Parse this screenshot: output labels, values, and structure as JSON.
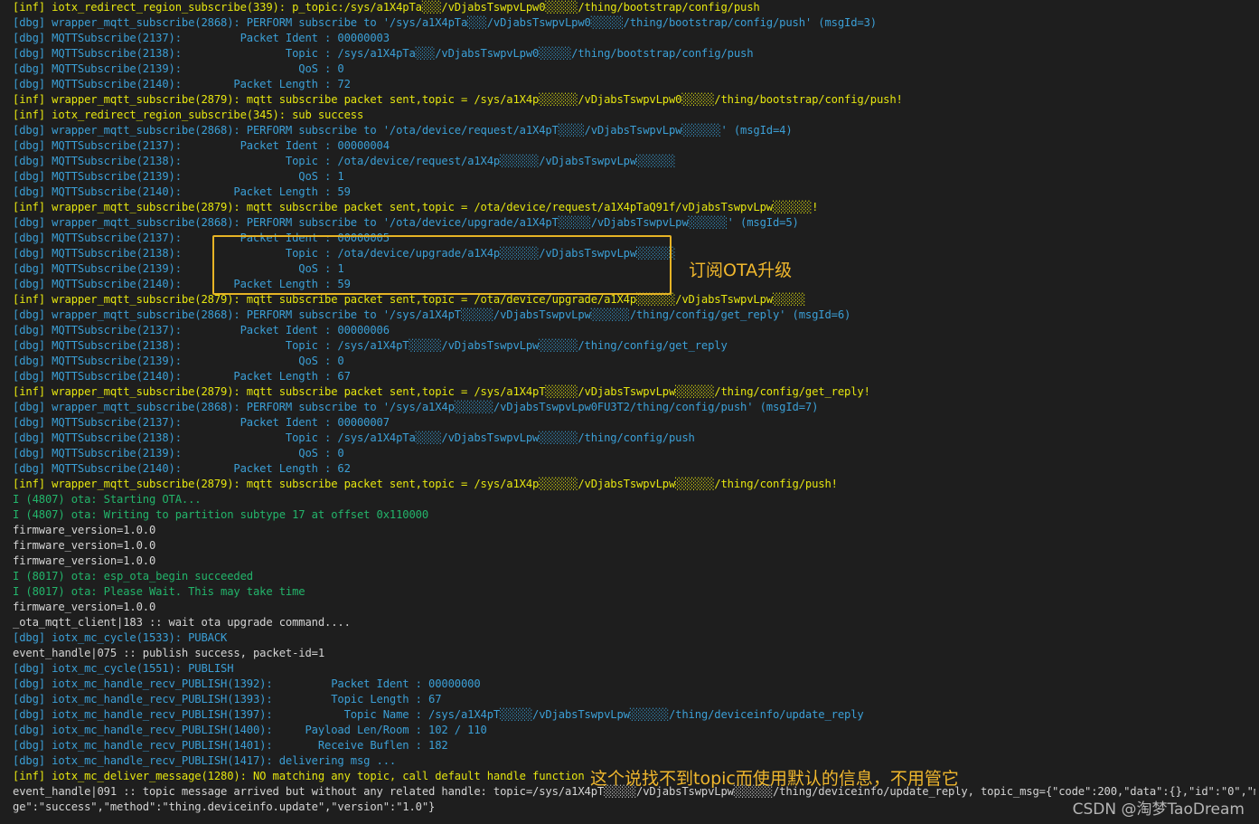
{
  "terminal": {
    "lines": [
      {
        "t": "[inf] iotx_redirect_region_subscribe(339): p_topic:/sys/a1X4pTa░░░/vDjabsTswpvLpw0░░░░░/thing/bootstrap/config/push",
        "k": "inf"
      },
      {
        "t": "[dbg] wrapper_mqtt_subscribe(2868): PERFORM subscribe to '/sys/a1X4pTa░░░/vDjabsTswpvLpw0░░░░░/thing/bootstrap/config/push' (msgId=3)",
        "k": "dbg"
      },
      {
        "t": "[dbg] MQTTSubscribe(2137):         Packet Ident : 00000003",
        "k": "dbg"
      },
      {
        "t": "[dbg] MQTTSubscribe(2138):                Topic : /sys/a1X4pTa░░░/vDjabsTswpvLpw0░░░░░/thing/bootstrap/config/push",
        "k": "dbg"
      },
      {
        "t": "[dbg] MQTTSubscribe(2139):                  QoS : 0",
        "k": "dbg"
      },
      {
        "t": "[dbg] MQTTSubscribe(2140):        Packet Length : 72",
        "k": "dbg"
      },
      {
        "t": "[inf] wrapper_mqtt_subscribe(2879): mqtt subscribe packet sent,topic = /sys/a1X4p░░░░░░/vDjabsTswpvLpw0░░░░░/thing/bootstrap/config/push!",
        "k": "inf"
      },
      {
        "t": "[inf] iotx_redirect_region_subscribe(345): sub success",
        "k": "inf"
      },
      {
        "t": "[dbg] wrapper_mqtt_subscribe(2868): PERFORM subscribe to '/ota/device/request/a1X4pT░░░░/vDjabsTswpvLpw░░░░░░' (msgId=4)",
        "k": "dbg"
      },
      {
        "t": "[dbg] MQTTSubscribe(2137):         Packet Ident : 00000004",
        "k": "dbg"
      },
      {
        "t": "[dbg] MQTTSubscribe(2138):                Topic : /ota/device/request/a1X4p░░░░░░/vDjabsTswpvLpw░░░░░░",
        "k": "dbg"
      },
      {
        "t": "[dbg] MQTTSubscribe(2139):                  QoS : 1",
        "k": "dbg"
      },
      {
        "t": "[dbg] MQTTSubscribe(2140):        Packet Length : 59",
        "k": "dbg"
      },
      {
        "t": "[inf] wrapper_mqtt_subscribe(2879): mqtt subscribe packet sent,topic = /ota/device/request/a1X4pTaQ91f/vDjabsTswpvLpw░░░░░░!",
        "k": "inf"
      },
      {
        "t": "[dbg] wrapper_mqtt_subscribe(2868): PERFORM subscribe to '/ota/device/upgrade/a1X4pT░░░░░/vDjabsTswpvLpw░░░░░░' (msgId=5)",
        "k": "dbg"
      },
      {
        "t": "[dbg] MQTTSubscribe(2137):         Packet Ident : 00000005",
        "k": "dbg"
      },
      {
        "t": "[dbg] MQTTSubscribe(2138):                Topic : /ota/device/upgrade/a1X4p░░░░░░/vDjabsTswpvLpw░░░░░░",
        "k": "dbg"
      },
      {
        "t": "[dbg] MQTTSubscribe(2139):                  QoS : 1",
        "k": "dbg"
      },
      {
        "t": "[dbg] MQTTSubscribe(2140):        Packet Length : 59",
        "k": "dbg"
      },
      {
        "t": "[inf] wrapper_mqtt_subscribe(2879): mqtt subscribe packet sent,topic = /ota/device/upgrade/a1X4p░░░░░░/vDjabsTswpvLpw░░░░░",
        "k": "inf"
      },
      {
        "t": "[dbg] wrapper_mqtt_subscribe(2868): PERFORM subscribe to '/sys/a1X4pT░░░░░/vDjabsTswpvLpw░░░░░░/thing/config/get_reply' (msgId=6)",
        "k": "dbg"
      },
      {
        "t": "[dbg] MQTTSubscribe(2137):         Packet Ident : 00000006",
        "k": "dbg"
      },
      {
        "t": "[dbg] MQTTSubscribe(2138):                Topic : /sys/a1X4pT░░░░░/vDjabsTswpvLpw░░░░░░/thing/config/get_reply",
        "k": "dbg"
      },
      {
        "t": "[dbg] MQTTSubscribe(2139):                  QoS : 0",
        "k": "dbg"
      },
      {
        "t": "[dbg] MQTTSubscribe(2140):        Packet Length : 67",
        "k": "dbg"
      },
      {
        "t": "[inf] wrapper_mqtt_subscribe(2879): mqtt subscribe packet sent,topic = /sys/a1X4pT░░░░░/vDjabsTswpvLpw░░░░░░/thing/config/get_reply!",
        "k": "inf"
      },
      {
        "t": "[dbg] wrapper_mqtt_subscribe(2868): PERFORM subscribe to '/sys/a1X4p░░░░░░/vDjabsTswpvLpw0FU3T2/thing/config/push' (msgId=7)",
        "k": "dbg"
      },
      {
        "t": "[dbg] MQTTSubscribe(2137):         Packet Ident : 00000007",
        "k": "dbg"
      },
      {
        "t": "[dbg] MQTTSubscribe(2138):                Topic : /sys/a1X4pTa░░░░/vDjabsTswpvLpw░░░░░░/thing/config/push",
        "k": "dbg"
      },
      {
        "t": "[dbg] MQTTSubscribe(2139):                  QoS : 0",
        "k": "dbg"
      },
      {
        "t": "[dbg] MQTTSubscribe(2140):        Packet Length : 62",
        "k": "dbg"
      },
      {
        "t": "[inf] wrapper_mqtt_subscribe(2879): mqtt subscribe packet sent,topic = /sys/a1X4p░░░░░░/vDjabsTswpvLpw░░░░░░/thing/config/push!",
        "k": "inf"
      },
      {
        "t": "I (4807) ota: Starting OTA...",
        "k": "ota"
      },
      {
        "t": "I (4807) ota: Writing to partition subtype 17 at offset 0x110000",
        "k": "ota"
      },
      {
        "t": "firmware_version=1.0.0",
        "k": "plain"
      },
      {
        "t": "firmware_version=1.0.0",
        "k": "plain"
      },
      {
        "t": "firmware_version=1.0.0",
        "k": "plain"
      },
      {
        "t": "I (8017) ota: esp_ota_begin succeeded",
        "k": "ota"
      },
      {
        "t": "I (8017) ota: Please Wait. This may take time",
        "k": "ota"
      },
      {
        "t": "firmware_version=1.0.0",
        "k": "plain"
      },
      {
        "t": "_ota_mqtt_client|183 :: wait ota upgrade command....",
        "k": "plain"
      },
      {
        "t": "[dbg] iotx_mc_cycle(1533): PUBACK",
        "k": "dbg"
      },
      {
        "t": "event_handle|075 :: publish success, packet-id=1",
        "k": "plain"
      },
      {
        "t": "[dbg] iotx_mc_cycle(1551): PUBLISH",
        "k": "dbg"
      },
      {
        "t": "[dbg] iotx_mc_handle_recv_PUBLISH(1392):         Packet Ident : 00000000",
        "k": "dbg"
      },
      {
        "t": "[dbg] iotx_mc_handle_recv_PUBLISH(1393):         Topic Length : 67",
        "k": "dbg"
      },
      {
        "t": "[dbg] iotx_mc_handle_recv_PUBLISH(1397):           Topic Name : /sys/a1X4pT░░░░░/vDjabsTswpvLpw░░░░░░/thing/deviceinfo/update_reply",
        "k": "dbg"
      },
      {
        "t": "[dbg] iotx_mc_handle_recv_PUBLISH(1400):     Payload Len/Room : 102 / 110",
        "k": "dbg"
      },
      {
        "t": "[dbg] iotx_mc_handle_recv_PUBLISH(1401):       Receive Buflen : 182",
        "k": "dbg"
      },
      {
        "t": "[dbg] iotx_mc_handle_recv_PUBLISH(1417): delivering msg ...",
        "k": "dbg"
      },
      {
        "t": "[inf] iotx_mc_deliver_message(1280): NO matching any topic, call default handle function",
        "k": "inf"
      },
      {
        "t": "event_handle|091 :: topic message arrived but without any related handle: topic=/sys/a1X4pT░░░░░/vDjabsTswpvLpw░░░░░░/thing/deviceinfo/update_reply, topic_msg={\"code\":200,\"data\":{},\"id\":\"0\",\"messa",
        "k": "plain"
      },
      {
        "t": "ge\":\"success\",\"method\":\"thing.deviceinfo.update\",\"version\":\"1.0\"}",
        "k": "plain"
      }
    ]
  },
  "annotations": {
    "ota_note": "订阅OTA升级",
    "topic_note": "这个说找不到topic而使用默认的信息，不用管它",
    "ota_box_color": "#e6b325"
  },
  "watermark": "CSDN @淘梦TaoDream",
  "colors": {
    "background": "#1e1e1e",
    "inf": "#e5e510",
    "dbg": "#3b9fd6",
    "ota": "#23b56b",
    "plain": "#d4d4d4",
    "annotation": "#f0b72d"
  }
}
